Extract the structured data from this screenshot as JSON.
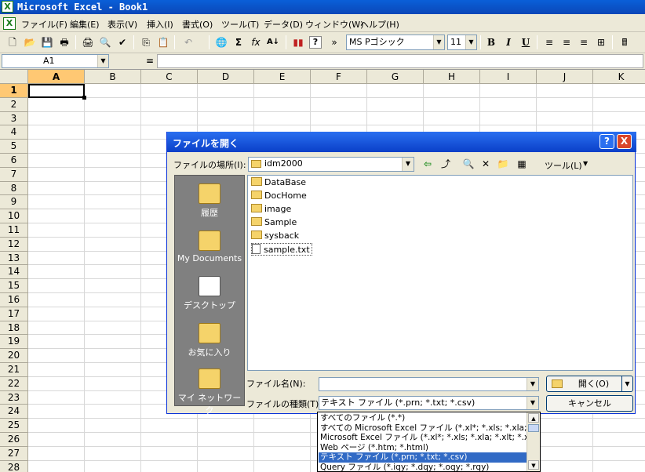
{
  "app": {
    "window_title": "Microsoft Excel - Book1",
    "app_icon": "excel-icon"
  },
  "menu": {
    "items": [
      "ファイル(F)",
      "編集(E)",
      "表示(V)",
      "挿入(I)",
      "書式(O)",
      "ツール(T)",
      "データ(D)",
      "ウィンドウ(W)",
      "ヘルプ(H)"
    ]
  },
  "toolbar": {
    "font_name": "MS Pゴシック",
    "font_size": "11",
    "bold": "B",
    "italic": "I",
    "underline": "U",
    "sum": "Σ",
    "fx": "fx",
    "help": "?",
    "more": "»"
  },
  "formula_bar": {
    "name_box": "A1",
    "equals": "="
  },
  "grid": {
    "columns": [
      "A",
      "B",
      "C",
      "D",
      "E",
      "F",
      "G",
      "H",
      "I",
      "J",
      "K"
    ],
    "rows": [
      "1",
      "2",
      "3",
      "4",
      "5",
      "6",
      "7",
      "8",
      "9",
      "10",
      "11",
      "12",
      "13",
      "14",
      "15",
      "16",
      "17",
      "18",
      "19",
      "20",
      "21",
      "22",
      "23",
      "24",
      "25",
      "26",
      "27",
      "28"
    ]
  },
  "dialog": {
    "title": "ファイルを開く",
    "help_button": "?",
    "close_button": "X",
    "look_in_label": "ファイルの場所(I):",
    "look_in_value": "idm2000",
    "tools_label": "ツール(L)",
    "places": [
      {
        "label": "履歴",
        "icon": "history-icon"
      },
      {
        "label": "My Documents",
        "icon": "my-documents-icon"
      },
      {
        "label": "デスクトップ",
        "icon": "desktop-icon"
      },
      {
        "label": "お気に入り",
        "icon": "favorites-icon"
      },
      {
        "label": "マイ ネットワーク",
        "icon": "network-icon"
      }
    ],
    "files": [
      {
        "name": "DataBase",
        "type": "folder"
      },
      {
        "name": "DocHome",
        "type": "folder"
      },
      {
        "name": "image",
        "type": "folder"
      },
      {
        "name": "Sample",
        "type": "folder"
      },
      {
        "name": "sysback",
        "type": "folder"
      },
      {
        "name": "sample.txt",
        "type": "text"
      }
    ],
    "filename_label": "ファイル名(N):",
    "filename_value": "",
    "filetype_label": "ファイルの種類(T):",
    "filetype_value": "テキスト ファイル (*.prn; *.txt; *.csv)",
    "open_button": "開く(O)",
    "cancel_button": "キャンセル",
    "filetype_options": [
      "すべてのファイル (*.*)",
      "すべての Microsoft Excel ファイル (*.xl*; *.xls; *.xla; *.",
      "Microsoft Excel ファイル (*.xl*; *.xls; *.xla; *.xlt; *.xlm",
      "Web ページ (*.htm; *.html)",
      "テキスト ファイル (*.prn; *.txt; *.csv)",
      "Query ファイル (*.iqy; *.dqy; *.oqy; *.rqy)"
    ],
    "selected_option_index": 4
  },
  "colors": {
    "title_blue": "#0b47b8",
    "highlight": "#316ac5",
    "annotation_red": "#e21313"
  }
}
